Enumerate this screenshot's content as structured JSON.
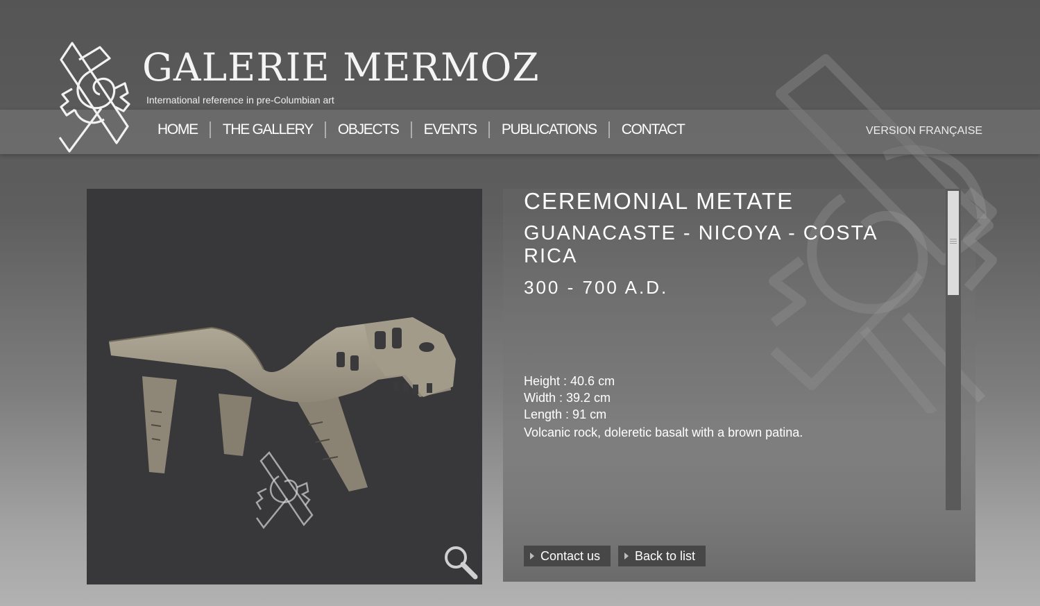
{
  "brand": {
    "name": "GALERIE MERMOZ",
    "tagline": "International reference in pre-Columbian art",
    "logo_icon": "interlaced-glyph-icon"
  },
  "nav": {
    "items": [
      {
        "label": "HOME"
      },
      {
        "label": "THE GALLERY"
      },
      {
        "label": "OBJECTS"
      },
      {
        "label": "EVENTS"
      },
      {
        "label": "PUBLICATIONS"
      },
      {
        "label": "CONTACT"
      }
    ],
    "language_link": "VERSION FRANÇAISE"
  },
  "object": {
    "title": "CEREMONIAL METATE",
    "origin": "GUANACASTE - NICOYA - COSTA RICA",
    "date": "300 - 700 A.D.",
    "specs": {
      "height": "Height : 40.6 cm",
      "width": "Width : 39.2 cm",
      "length": "Length : 91 cm",
      "material": "Volcanic rock, doleretic basalt with a brown patina."
    }
  },
  "buttons": {
    "contact": "Contact us",
    "back": "Back to list"
  },
  "icons": {
    "zoom": "magnifier-icon",
    "watermark": "gallery-watermark-icon"
  },
  "colors": {
    "photo_background": "#38383a",
    "button_background": "#474747",
    "scrollbar_track": "#5a5a5a",
    "scrollbar_thumb": "#dcdcdc"
  }
}
